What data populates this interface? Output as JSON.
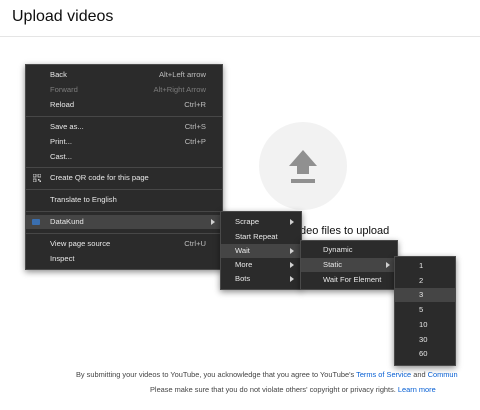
{
  "header": {
    "title": "Upload videos"
  },
  "upload": {
    "drag_text": "deo files to upload"
  },
  "footer": {
    "line1_prefix": "By submitting your videos to YouTube, you acknowledge that you agree to YouTube's",
    "tos_link": "Terms of Service",
    "line1_and": "and",
    "community_link": "Commun",
    "line2_text": "Please make sure that you do not violate others' copyright or privacy rights.",
    "learn_more": "Learn more"
  },
  "context_menu": {
    "items": [
      {
        "label": "Back",
        "shortcut": "Alt+Left arrow"
      },
      {
        "label": "Forward",
        "shortcut": "Alt+Right Arrow"
      },
      {
        "label": "Reload",
        "shortcut": "Ctrl+R"
      },
      {
        "label": "Save as...",
        "shortcut": "Ctrl+S"
      },
      {
        "label": "Print...",
        "shortcut": "Ctrl+P"
      },
      {
        "label": "Cast..."
      },
      {
        "label": "Create QR code for this page"
      },
      {
        "label": "Translate to English"
      },
      {
        "label": "DataKund"
      },
      {
        "label": "View page source",
        "shortcut": "Ctrl+U"
      },
      {
        "label": "Inspect"
      }
    ]
  },
  "datakund_menu": {
    "items": [
      {
        "label": "Scrape"
      },
      {
        "label": "Start Repeat"
      },
      {
        "label": "Wait"
      },
      {
        "label": "More"
      },
      {
        "label": "Bots"
      }
    ]
  },
  "wait_menu": {
    "items": [
      {
        "label": "Dynamic"
      },
      {
        "label": "Static"
      },
      {
        "label": "Wait For Element"
      }
    ]
  },
  "static_menu": {
    "items": [
      {
        "label": "1"
      },
      {
        "label": "2"
      },
      {
        "label": "3"
      },
      {
        "label": "5"
      },
      {
        "label": "10"
      },
      {
        "label": "30"
      },
      {
        "label": "60"
      }
    ]
  }
}
